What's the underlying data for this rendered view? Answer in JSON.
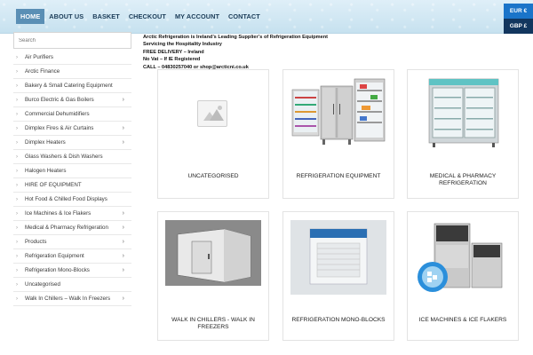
{
  "nav": {
    "items": [
      "HOME",
      "ABOUT US",
      "BASKET",
      "CHECKOUT",
      "MY ACCOUNT",
      "CONTACT"
    ],
    "active": "HOME"
  },
  "currency": {
    "eur": "EUR €",
    "gbp": "GBP £"
  },
  "search": {
    "placeholder": "Search"
  },
  "sidebar": {
    "items": [
      {
        "label": "Air Purifiers",
        "has_sub": false
      },
      {
        "label": "Arctic Finance",
        "has_sub": false
      },
      {
        "label": "Bakery & Small Catering Equipment",
        "has_sub": false
      },
      {
        "label": "Burco Electric & Gas Boilers",
        "has_sub": true
      },
      {
        "label": "Commercial Dehumidifiers",
        "has_sub": false
      },
      {
        "label": "Dimplex Fires & Air Curtains",
        "has_sub": true
      },
      {
        "label": "Dimplex Heaters",
        "has_sub": true
      },
      {
        "label": "Glass Washers & Dish Washers",
        "has_sub": false
      },
      {
        "label": "Halogen Heaters",
        "has_sub": false
      },
      {
        "label": "HIRE OF EQUIPMENT",
        "has_sub": false
      },
      {
        "label": "Hot Food & Chilled Food Displays",
        "has_sub": false
      },
      {
        "label": "Ice Machines & Ice Flakers",
        "has_sub": true
      },
      {
        "label": "Medical & Pharmacy Refrigeration",
        "has_sub": true
      },
      {
        "label": "Products",
        "has_sub": true
      },
      {
        "label": "Refrigeration Equipment",
        "has_sub": true
      },
      {
        "label": "Refrigeration Mono-Blocks",
        "has_sub": true
      },
      {
        "label": "Uncategorised",
        "has_sub": false
      },
      {
        "label": "Walk In Chillers – Walk In Freezers",
        "has_sub": true
      }
    ]
  },
  "intro": {
    "lines": [
      "Arctic Refrigeration is Ireland’s Leading Supplier’s of Refrigeration Equipment",
      "Servicing the Hospitality Industry",
      "FREE DELIVERY – Ireland",
      "No Vat – If IE Registered",
      "CALL – 04830257040 or shop@arcticni.co.uk"
    ]
  },
  "products": [
    {
      "title": "UNCATEGORISED",
      "image": "placeholder-image"
    },
    {
      "title": "REFRIGERATION EQUIPMENT",
      "image": "refrigerators-image"
    },
    {
      "title": "MEDICAL & PHARMACY REFRIGERATION",
      "image": "pharmacy-fridge-image"
    },
    {
      "title": "WALK IN CHILLERS - WALK IN FREEZERS",
      "image": "walk-in-chiller-image"
    },
    {
      "title": "REFRIGERATION MONO-BLOCKS",
      "image": "mono-block-image"
    },
    {
      "title": "ICE MACHINES & ICE FLAKERS",
      "image": "ice-machine-image"
    }
  ],
  "colors": {
    "nav_active": "#5a8fb5",
    "eur": "#1a74c9",
    "gbp": "#12365e"
  }
}
